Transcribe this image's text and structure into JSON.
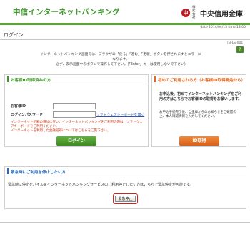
{
  "header": {
    "brand": "中信インターネットバンキング",
    "bank_logo": "中",
    "bank_small": "株式会社",
    "bank_name": "中央信用金庫"
  },
  "datebar": {
    "text": "date 2014/04/15 time 13:00"
  },
  "page": {
    "title": "ログイン",
    "code": "[B-LS-001]",
    "help_icon": "?"
  },
  "notice": {
    "line1": "インターネットバンキング画面では、ブラウザの「戻る」「進む」「更新」ボタンを押されますとエラーになります。",
    "line2": "必ず、表示画面中のボタンで操作して下さい。(「Enter」キーは使用しないで下さい)"
  },
  "login_panel": {
    "title": "お客様ID取得済みの方",
    "id_label": "お客様ID",
    "password_label": "ログインパスワード",
    "software_keyboard_link": "ソフトウェアキーボードを開く",
    "warning1": "インターネット犯罪の増加に伴い、インターネットバンキングをご利用の際は、ソフトウェアキーボードをご利用ください。",
    "warning2": "インターネットを利用した金融犯罪についてはこちらをご覧下さい。",
    "login_button": "ログイン",
    "accent_color": "#3f9a2a"
  },
  "first_panel": {
    "title": "初めてご利用される方（お客様ID取得開始から）",
    "text_bold": "お申込後、初めてインターネットバンキングをご利用の方はこちらでお客様IDの取得をお願いします。",
    "text_sub": "お申込手続完了後、当金庫からのお知らせをご確認の上、本人確認情報を入力してください。",
    "button": "ID取得",
    "accent_color": "#e26a1f"
  },
  "stop_panel": {
    "title": "緊急時にご利用を停止したい方",
    "text": "緊急時に停止をパイル＆インターネットバンキングサービスのご利用停止したい方はこちらで緊急停止が可能です。",
    "button": "緊急停止",
    "accent_color": "#2a6ab8"
  }
}
